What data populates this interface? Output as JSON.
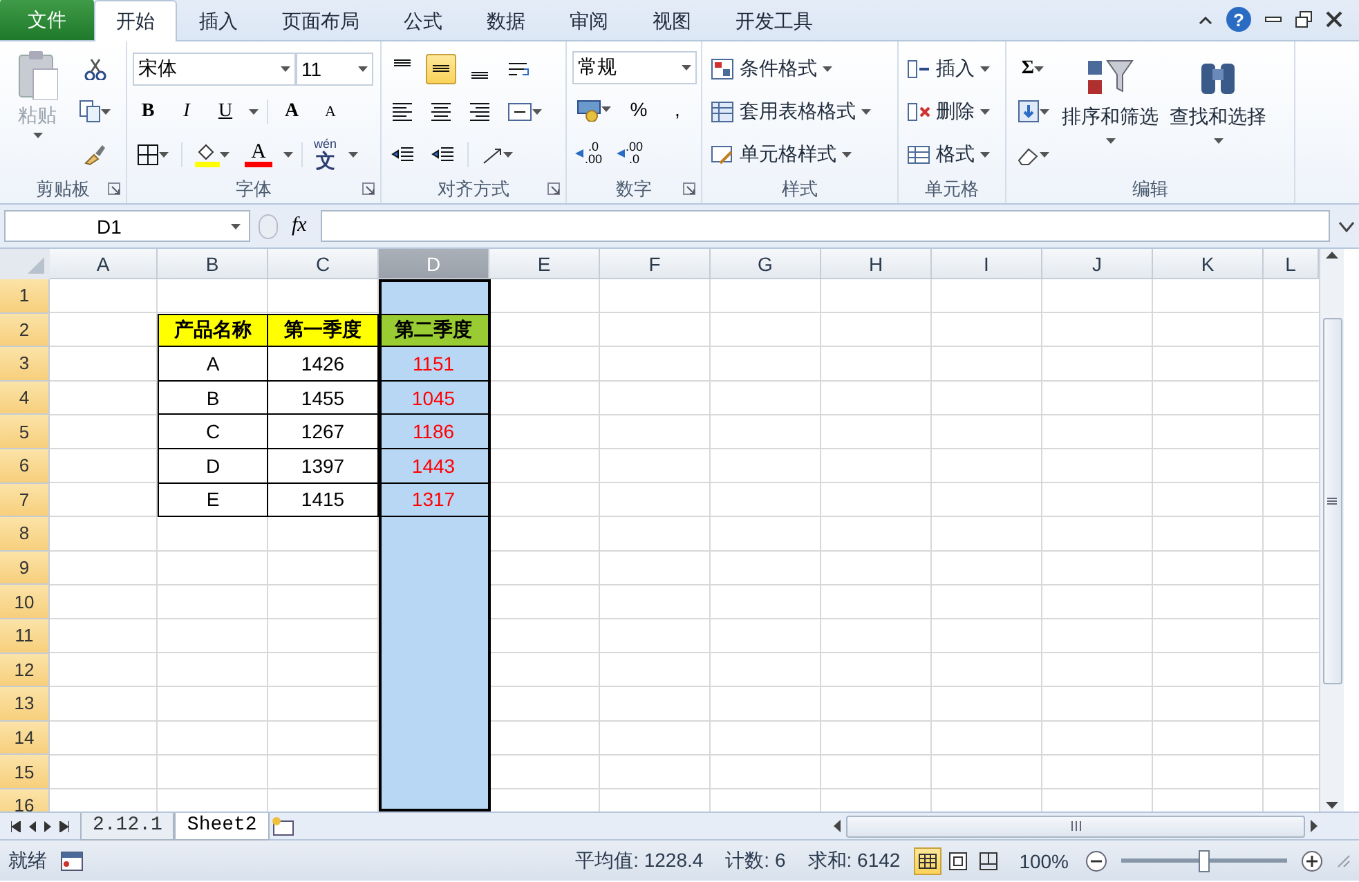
{
  "tabs": [
    {
      "label": "文件",
      "kind": "file",
      "selected": false
    },
    {
      "label": "开始",
      "kind": "tab",
      "selected": true
    },
    {
      "label": "插入",
      "kind": "tab",
      "selected": false
    },
    {
      "label": "页面布局",
      "kind": "tab",
      "selected": false
    },
    {
      "label": "公式",
      "kind": "tab",
      "selected": false
    },
    {
      "label": "数据",
      "kind": "tab",
      "selected": false
    },
    {
      "label": "审阅",
      "kind": "tab",
      "selected": false
    },
    {
      "label": "视图",
      "kind": "tab",
      "selected": false
    },
    {
      "label": "开发工具",
      "kind": "tab",
      "selected": false
    }
  ],
  "help": "?",
  "ribbon": {
    "groups": [
      {
        "kind": "clipboard",
        "label": "剪贴板",
        "paste": {
          "label": "粘贴",
          "disabled": true
        }
      },
      {
        "kind": "font",
        "label": "字体",
        "font_name": "宋体",
        "font_size": "11",
        "styles": [
          "B",
          "I",
          "U"
        ],
        "grow": "A",
        "shrink": "A",
        "font_color": "A",
        "phonetic": {
          "top": "wén",
          "bottom": "文"
        }
      },
      {
        "kind": "alignment",
        "label": "对齐方式",
        "vertical_align": [
          {
            "selected": false
          },
          {
            "selected": true
          },
          {
            "selected": false
          }
        ]
      },
      {
        "kind": "number",
        "label": "数字",
        "format": "常规",
        "symbols": [
          "%",
          ","
        ],
        "increase_decimal": {
          "top": ".0",
          "bottom": ".00"
        },
        "decrease_decimal": {
          "top": ".00",
          "bottom": ".0"
        }
      },
      {
        "kind": "styles",
        "label": "样式",
        "buttons": [
          "条件格式",
          "套用表格格式",
          "单元格样式"
        ]
      },
      {
        "kind": "cells",
        "label": "单元格",
        "buttons": [
          "插入",
          "删除",
          "格式"
        ]
      },
      {
        "kind": "editing",
        "label": "编辑",
        "sum": "Σ",
        "buttons": [
          "排序和筛选",
          "查找和选择"
        ]
      }
    ]
  },
  "formula_bar": {
    "name_box": "D1",
    "function_button": "fx"
  },
  "sheet": {
    "columns": [
      {
        "label": "A",
        "selected": false
      },
      {
        "label": "B",
        "selected": false
      },
      {
        "label": "C",
        "selected": false
      },
      {
        "label": "D",
        "selected": true
      },
      {
        "label": "E",
        "selected": false
      },
      {
        "label": "F",
        "selected": false
      },
      {
        "label": "G",
        "selected": false
      },
      {
        "label": "H",
        "selected": false
      },
      {
        "label": "I",
        "selected": false
      },
      {
        "label": "J",
        "selected": false
      },
      {
        "label": "K",
        "selected": false
      },
      {
        "label": "L",
        "selected": false
      }
    ],
    "rows": [
      {
        "label": "1",
        "selected": true
      },
      {
        "label": "2",
        "selected": true
      },
      {
        "label": "3",
        "selected": true
      },
      {
        "label": "4",
        "selected": true
      },
      {
        "label": "5",
        "selected": true
      },
      {
        "label": "6",
        "selected": true
      },
      {
        "label": "7",
        "selected": true
      },
      {
        "label": "8",
        "selected": true
      },
      {
        "label": "9",
        "selected": true
      },
      {
        "label": "10",
        "selected": true
      },
      {
        "label": "11",
        "selected": true
      },
      {
        "label": "12",
        "selected": true
      },
      {
        "label": "13",
        "selected": true
      },
      {
        "label": "14",
        "selected": true
      },
      {
        "label": "15",
        "selected": true
      },
      {
        "label": "16",
        "selected": true
      }
    ],
    "table": {
      "columns": [
        {
          "header": "产品名称",
          "color": "#ffff00",
          "red_values": false
        },
        {
          "header": "第一季度",
          "color": "#ffff00",
          "red_values": false
        },
        {
          "header": "第二季度",
          "color": "#99cc33",
          "red_values": true
        }
      ],
      "rows": [
        [
          "A",
          "1426",
          "1151"
        ],
        [
          "B",
          "1455",
          "1045"
        ],
        [
          "C",
          "1267",
          "1186"
        ],
        [
          "D",
          "1397",
          "1443"
        ],
        [
          "E",
          "1415",
          "1317"
        ]
      ]
    }
  },
  "sheet_tabs": [
    {
      "label": "2.12.1",
      "selected": false
    },
    {
      "label": "Sheet2",
      "selected": true
    }
  ],
  "status_bar": {
    "mode": "就绪",
    "stats": [
      "平均值: 1228.4",
      "计数: 6",
      "求和: 6142"
    ],
    "views": [
      {
        "selected": true
      },
      {
        "selected": false
      },
      {
        "selected": false
      }
    ],
    "zoom": "100%",
    "zoom_slider": {
      "level": 0.5
    }
  }
}
